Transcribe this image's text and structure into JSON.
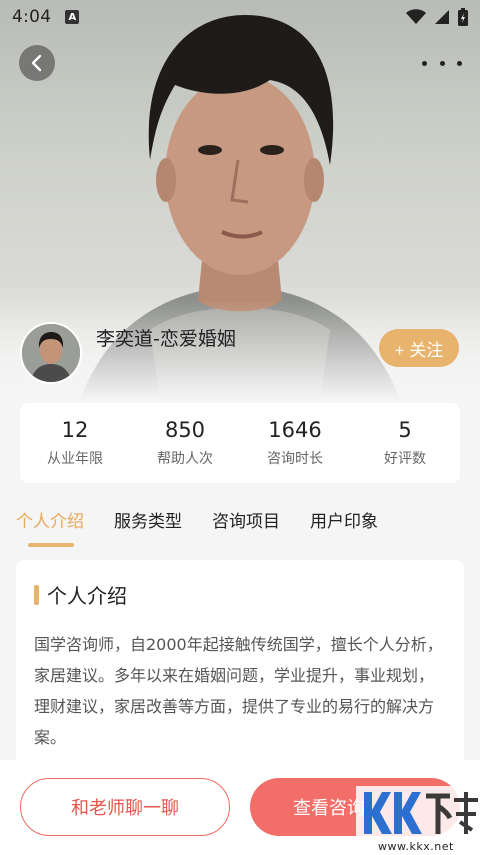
{
  "status_bar": {
    "time": "4:04",
    "notification_letter": "A"
  },
  "profile": {
    "name": "李奕道-恋爱婚姻",
    "follow_label": "+ 关注"
  },
  "stats": [
    {
      "value": "12",
      "label": "从业年限"
    },
    {
      "value": "850",
      "label": "帮助人次"
    },
    {
      "value": "1646",
      "label": "咨询时长"
    },
    {
      "value": "5",
      "label": "好评数"
    }
  ],
  "tabs": [
    {
      "label": "个人介绍",
      "active": true
    },
    {
      "label": "服务类型",
      "active": false
    },
    {
      "label": "咨询项目",
      "active": false
    },
    {
      "label": "用户印象",
      "active": false
    }
  ],
  "intro_section": {
    "title": "个人介绍",
    "text": "国学咨询师，自2000年起接触传统国学，擅长个人分析，家居建议。多年以来在婚姻问题，学业提升，事业规划，理财建议，家居改善等方面，提供了专业的易行的解决方案。"
  },
  "bottom_bar": {
    "chat_label": "和老师聊一聊",
    "consult_label": "查看咨询"
  },
  "watermark": {
    "logo_text": "KK下载",
    "url": "www.kkx.net"
  },
  "colors": {
    "accent": "#e8b36c",
    "primary_red": "#f26e68",
    "background": "#f5f5f5"
  }
}
